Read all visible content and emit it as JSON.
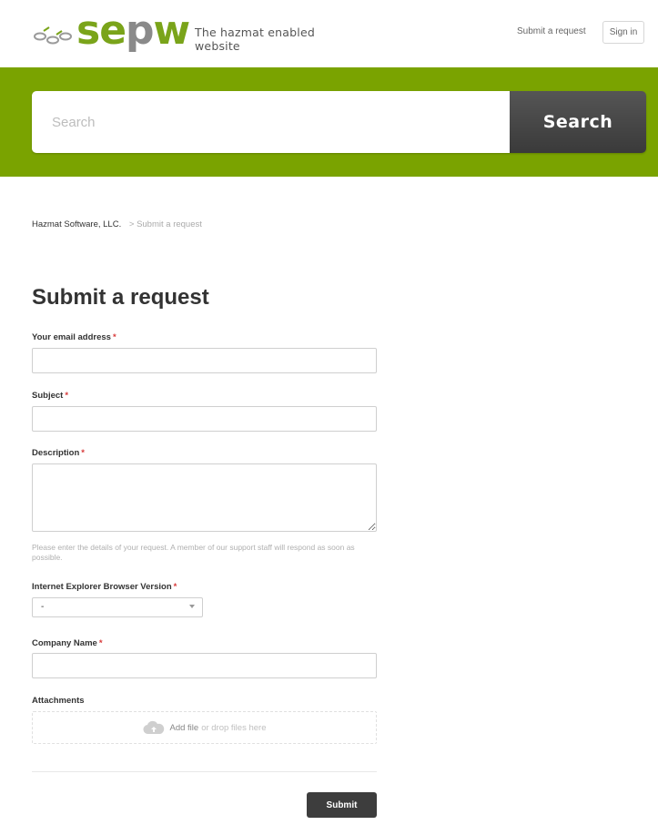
{
  "header": {
    "logo_text_a": "se",
    "logo_text_b": "p",
    "logo_text_c": "w",
    "tagline": "The hazmat enabled website",
    "submit_request_link": "Submit a request",
    "sign_in": "Sign in"
  },
  "search": {
    "placeholder": "Search",
    "button_label": "Search"
  },
  "breadcrumb": {
    "home": "Hazmat Software, LLC.",
    "separator": ">",
    "current": "Submit a request"
  },
  "form": {
    "title": "Submit a request",
    "required_mark": "*",
    "email_label": "Your email address",
    "subject_label": "Subject",
    "description_label": "Description",
    "description_hint": "Please enter the details of your request. A member of our support staff will respond as soon as possible.",
    "ie_version_label": "Internet Explorer Browser Version",
    "ie_version_value": "-",
    "company_label": "Company Name",
    "attachments_label": "Attachments",
    "add_file": "Add file",
    "drop_files": "or drop files here",
    "submit_label": "Submit"
  },
  "colors": {
    "brand_green": "#7aa300",
    "logo_gray": "#8a8a8a",
    "button_dark": "#3d3d3d",
    "required_red": "#d83a3a"
  }
}
